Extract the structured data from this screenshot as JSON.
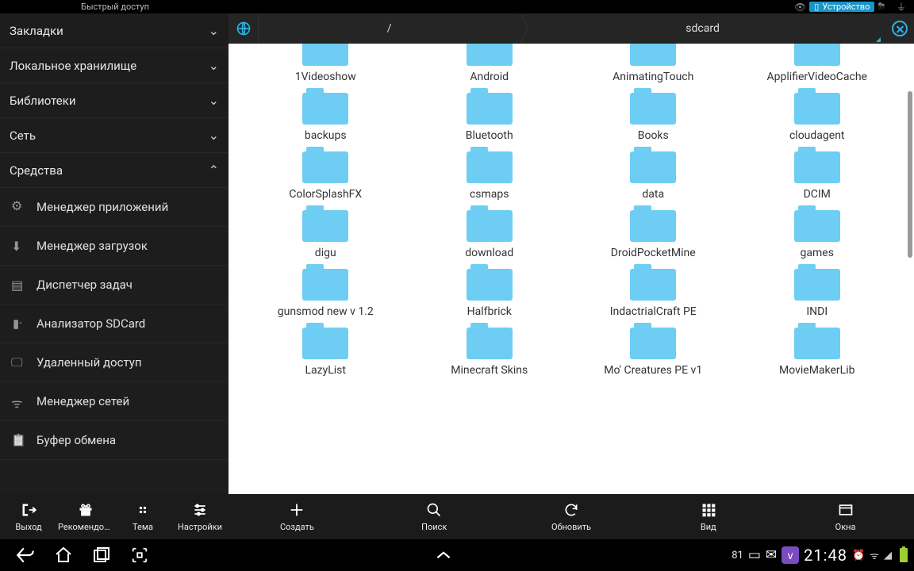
{
  "top_status": {
    "quick_access": "Быстрый доступ",
    "device_label": "Устройство"
  },
  "sidebar": {
    "sections": [
      {
        "label": "Закладки",
        "expanded": false
      },
      {
        "label": "Локальное хранилище",
        "expanded": false
      },
      {
        "label": "Библиотеки",
        "expanded": false
      },
      {
        "label": "Сеть",
        "expanded": false
      },
      {
        "label": "Средства",
        "expanded": true
      }
    ],
    "tools": [
      {
        "icon": "gear",
        "label": "Менеджер приложений"
      },
      {
        "icon": "download",
        "label": "Менеджер загрузок"
      },
      {
        "icon": "tasks",
        "label": "Диспетчер задач"
      },
      {
        "icon": "sd",
        "label": "Анализатор SDCard"
      },
      {
        "icon": "remote",
        "label": "Удаленный доступ"
      },
      {
        "icon": "wifi",
        "label": "Менеджер сетей"
      },
      {
        "icon": "clip",
        "label": "Буфер обмена"
      }
    ]
  },
  "breadcrumbs": [
    {
      "label": "/"
    },
    {
      "label": "sdcard"
    }
  ],
  "folders": [
    "1Videoshow",
    "Android",
    "AnimatingTouch",
    "ApplifierVideoCache",
    "backups",
    "Bluetooth",
    "Books",
    "cloudagent",
    "ColorSplashFX",
    "csmaps",
    "data",
    "DCIM",
    "digu",
    "download",
    "DroidPocketMine",
    "games",
    "gunsmod new v 1.2",
    "Halfbrick",
    "IndactrialCraft PE",
    "INDI",
    "LazyList",
    "Minecraft Skins",
    "Mo' Creatures PE v1",
    "MovieMakerLib"
  ],
  "bottom_sidebar": [
    {
      "label": "Выход",
      "icon": "exit"
    },
    {
      "label": "Рекомендов...",
      "icon": "gift"
    },
    {
      "label": "Тема",
      "icon": "palette"
    },
    {
      "label": "Настройки",
      "icon": "sliders"
    }
  ],
  "bottom_main": [
    {
      "label": "Создать",
      "icon": "plus"
    },
    {
      "label": "Поиск",
      "icon": "search"
    },
    {
      "label": "Обновить",
      "icon": "refresh"
    },
    {
      "label": "Вид",
      "icon": "grid"
    },
    {
      "label": "Окна",
      "icon": "windows"
    }
  ],
  "navbar": {
    "battery_pct": "81",
    "clock": "21:48"
  }
}
